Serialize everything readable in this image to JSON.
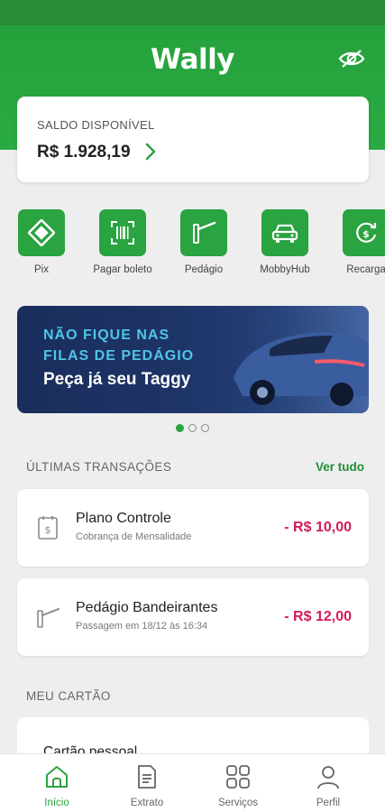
{
  "app": {
    "title": "Wally"
  },
  "colors": {
    "brand": "#2aa341",
    "debit": "#d11a5a",
    "banner_accent": "#4ec5e8"
  },
  "balance": {
    "label": "SALDO DISPONÍVEL",
    "value": "R$ 1.928,19"
  },
  "actions": [
    {
      "label": "Pix",
      "icon": "pix-icon"
    },
    {
      "label": "Pagar boleto",
      "icon": "barcode-scan-icon"
    },
    {
      "label": "Pedágio",
      "icon": "toll-gate-icon"
    },
    {
      "label": "MobbyHub",
      "icon": "car-icon"
    },
    {
      "label": "Recarga",
      "icon": "recharge-icon"
    }
  ],
  "banner": {
    "line1": "NÃO FIQUE NAS",
    "line2": "FILAS DE PEDÁGIO",
    "line3": "Peça já seu Taggy",
    "page_count": 3,
    "active_page": 1
  },
  "transactions": {
    "title": "ÚLTIMAS TRANSAÇÕES",
    "see_all": "Ver tudo",
    "items": [
      {
        "title": "Plano Controle",
        "subtitle": "Cobrança de Mensalidade",
        "amount": "- R$ 10,00",
        "icon": "bill-icon"
      },
      {
        "title": "Pedágio Bandeirantes",
        "subtitle": "Passagem em 18/12 às 16:34",
        "amount": "- R$ 12,00",
        "icon": "toll-gate-icon"
      }
    ]
  },
  "card": {
    "section_title": "MEU CARTÃO",
    "card_title": "Cartão pessoal"
  },
  "nav": {
    "items": [
      {
        "label": "Início",
        "icon": "home-icon",
        "active": true
      },
      {
        "label": "Extrato",
        "icon": "statement-icon",
        "active": false
      },
      {
        "label": "Serviços",
        "icon": "services-grid-icon",
        "active": false
      },
      {
        "label": "Perfil",
        "icon": "profile-icon",
        "active": false
      }
    ]
  }
}
